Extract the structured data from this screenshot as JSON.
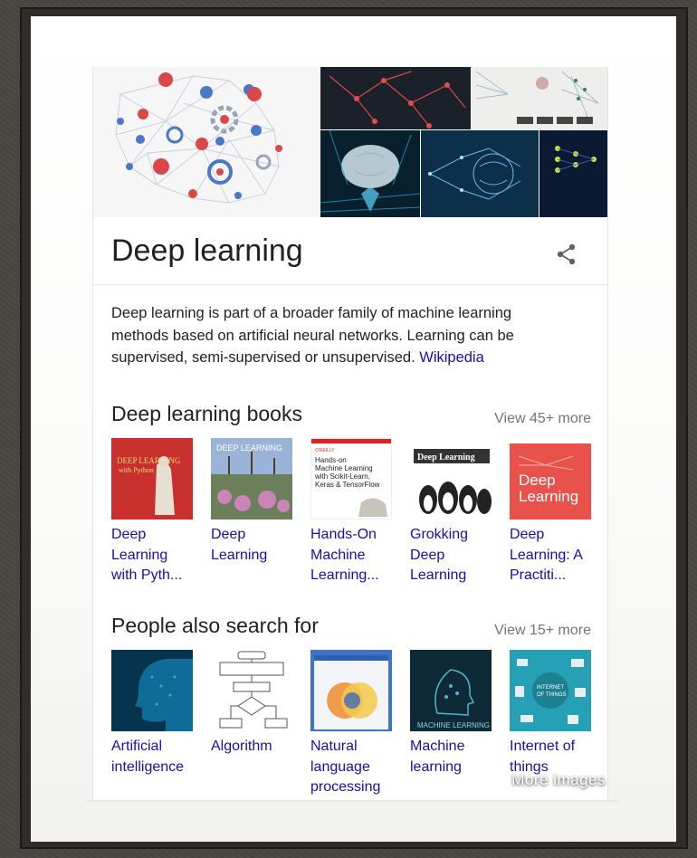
{
  "knowledge_panel": {
    "more_images": "More images",
    "title": "Deep learning",
    "description": "Deep learning is part of a broader family of machine learning methods based on artificial neural networks. Learning can be supervised, semi-supervised or unsupervised.",
    "source_link": "Wikipedia",
    "share_icon": "share-icon"
  },
  "books": {
    "title": "Deep learning books",
    "more": "View 45+ more",
    "items": [
      {
        "label": "Deep Learning with Pyth..."
      },
      {
        "label": "Deep Learning"
      },
      {
        "label": "Hands-On Machine Learning..."
      },
      {
        "label": "Grokking Deep Learning"
      },
      {
        "label": "Deep Learning: A Practiti..."
      }
    ]
  },
  "people_also_search": {
    "title": "People also search for",
    "more": "View 15+ more",
    "items": [
      {
        "label": "Artificial intelligence"
      },
      {
        "label": "Algorithm"
      },
      {
        "label": "Natural language processing"
      },
      {
        "label": "Machine learning"
      },
      {
        "label": "Internet of things"
      }
    ]
  },
  "colors": {
    "link": "#1a0dab",
    "text": "#202124",
    "muted": "#70757a"
  }
}
